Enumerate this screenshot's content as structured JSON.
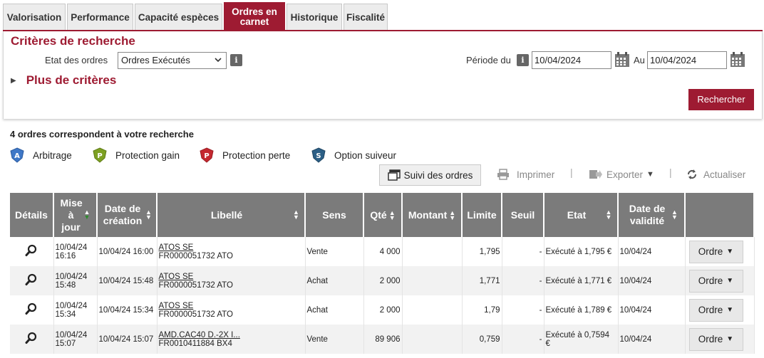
{
  "tabs": [
    {
      "label": "Valorisation",
      "active": false
    },
    {
      "label": "Performance",
      "active": false
    },
    {
      "label": "Capacité espèces",
      "active": false
    },
    {
      "label": "Ordres en carnet",
      "active": true
    },
    {
      "label": "Historique",
      "active": false
    },
    {
      "label": "Fiscalité",
      "active": false
    }
  ],
  "criteria": {
    "title": "Critères de recherche",
    "status_label": "Etat des ordres",
    "status_value": "Ordres Exécutés",
    "period_label": "Période du",
    "date_from": "10/04/2024",
    "date_to_label": "Au",
    "date_to": "10/04/2024",
    "more_label": "Plus de critères",
    "search_button": "Rechercher",
    "info_glyph": "i"
  },
  "results": {
    "count_text": "4 ordres correspondent à votre recherche",
    "legend": [
      {
        "icon": "arbitrage-icon",
        "letter": "A",
        "color": "#3f78c7",
        "label": "Arbitrage"
      },
      {
        "icon": "protection-gain-icon",
        "letter": "P",
        "color": "#7da022",
        "label": "Protection gain"
      },
      {
        "icon": "protection-perte-icon",
        "letter": "P",
        "color": "#c4282f",
        "label": "Protection perte"
      },
      {
        "icon": "option-suiveur-icon",
        "letter": "S",
        "color": "#2c5f86",
        "label": "Option suiveur"
      }
    ],
    "toolbar": {
      "suivi": "Suivi des ordres",
      "print": "Imprimer",
      "export": "Exporter",
      "refresh": "Actualiser",
      "separator": "|"
    }
  },
  "table": {
    "headers": {
      "details": "Détails",
      "mise_a_jour": "Mise à jour",
      "date_creation": "Date de création",
      "libelle": "Libellé",
      "sens": "Sens",
      "qte": "Qté",
      "montant": "Montant",
      "limite": "Limite",
      "seuil": "Seuil",
      "etat": "Etat",
      "date_validite": "Date de validité"
    },
    "rows": [
      {
        "maj": "10/04/24 16:16",
        "creation": "10/04/24 16:00",
        "name": "ATOS SE",
        "isin": "FR0000051732 ATO",
        "sens": "Vente",
        "qte": "4 000",
        "montant": "",
        "limite": "1,795",
        "seuil": "-",
        "etat": "Exécuté à 1,795 €",
        "validite": "10/04/24",
        "action": "Ordre"
      },
      {
        "maj": "10/04/24 15:48",
        "creation": "10/04/24 15:48",
        "name": "ATOS SE",
        "isin": "FR0000051732 ATO",
        "sens": "Achat",
        "qte": "2 000",
        "montant": "",
        "limite": "1,771",
        "seuil": "-",
        "etat": "Exécuté à 1,771 €",
        "validite": "10/04/24",
        "action": "Ordre"
      },
      {
        "maj": "10/04/24 15:34",
        "creation": "10/04/24 15:34",
        "name": "ATOS SE",
        "isin": "FR0000051732 ATO",
        "sens": "Achat",
        "qte": "2 000",
        "montant": "",
        "limite": "1,79",
        "seuil": "-",
        "etat": "Exécuté à 1,789 €",
        "validite": "10/04/24",
        "action": "Ordre"
      },
      {
        "maj": "10/04/24 15:07",
        "creation": "10/04/24 15:07",
        "name": "AMD.CAC40 D.-2X I...",
        "isin": "FR0010411884 BX4",
        "sens": "Vente",
        "qte": "89 906",
        "montant": "",
        "limite": "0,759",
        "seuil": "-",
        "etat": "Exécuté à 0,7594 €",
        "validite": "10/04/24",
        "action": "Ordre"
      }
    ]
  }
}
